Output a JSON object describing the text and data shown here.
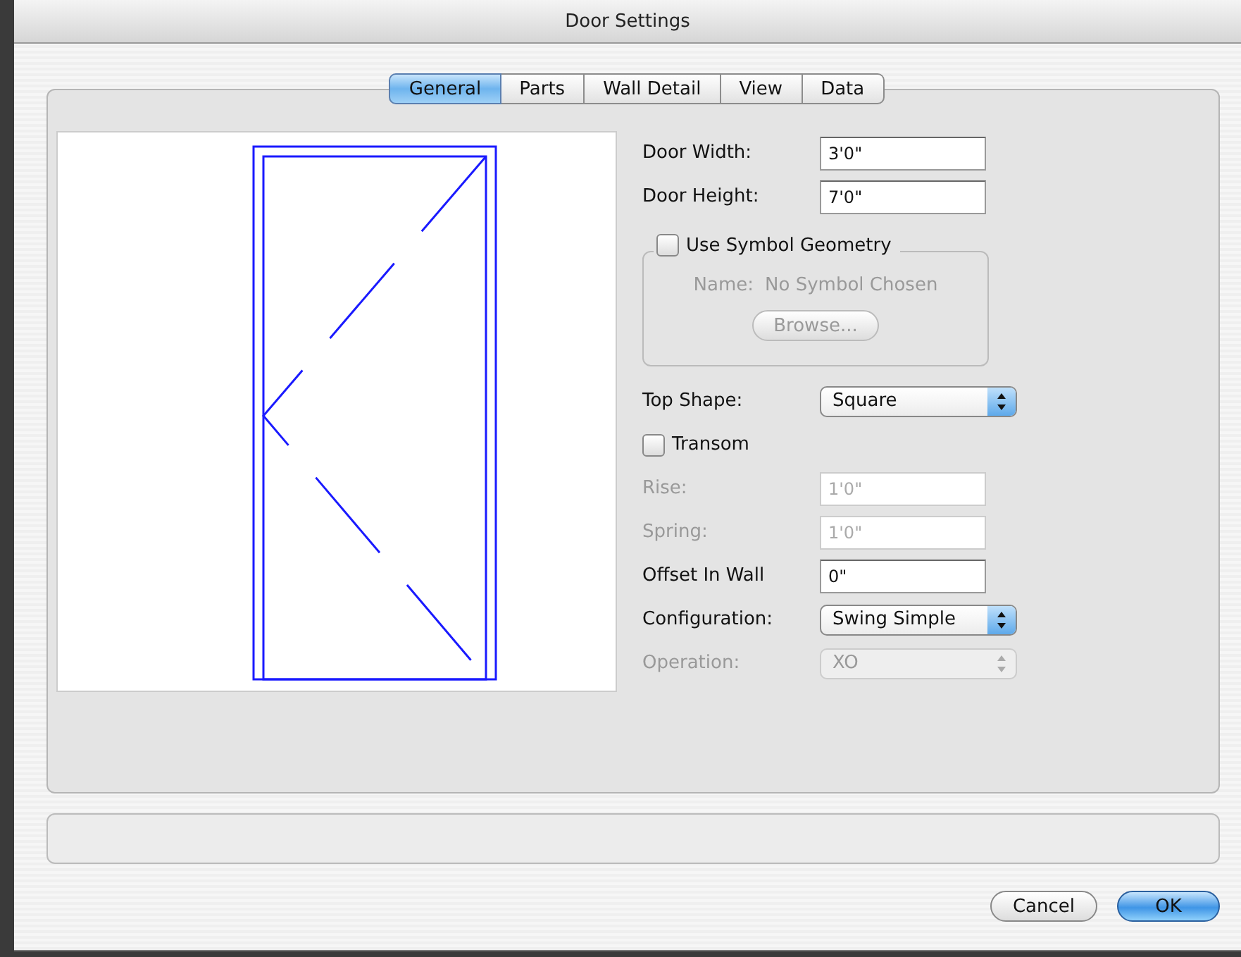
{
  "window": {
    "title": "Door Settings"
  },
  "tabs": [
    {
      "label": "General",
      "selected": true
    },
    {
      "label": "Parts",
      "selected": false
    },
    {
      "label": "Wall Detail",
      "selected": false
    },
    {
      "label": "View",
      "selected": false
    },
    {
      "label": "Data",
      "selected": false
    }
  ],
  "rows": [
    {
      "kind": "text",
      "label": "Door Width:",
      "value": "3'0\"",
      "disabled": false
    },
    {
      "kind": "text",
      "label": "Door Height:",
      "value": "7'0\"",
      "disabled": false
    },
    {
      "kind": "group",
      "label": "Use Symbol Geometry",
      "checked": false,
      "name_label": "Name:",
      "name_value": "No Symbol Chosen",
      "button": "Browse...",
      "disabled": true
    },
    {
      "kind": "select",
      "label": "Top Shape:",
      "value": "Square",
      "disabled": false
    },
    {
      "kind": "checkbox",
      "label": "Transom",
      "checked": false
    },
    {
      "kind": "text",
      "label": "Rise:",
      "value": "1'0\"",
      "disabled": true
    },
    {
      "kind": "text",
      "label": "Spring:",
      "value": "1'0\"",
      "disabled": true
    },
    {
      "kind": "text",
      "label": "Offset In Wall",
      "value": "0\"",
      "disabled": false
    },
    {
      "kind": "select",
      "label": "Configuration:",
      "value": "Swing Simple",
      "disabled": false
    },
    {
      "kind": "select",
      "label": "Operation:",
      "value": "XO",
      "disabled": true
    }
  ],
  "buttons": [
    {
      "label": "Cancel",
      "default": false
    },
    {
      "label": "OK",
      "default": true
    }
  ]
}
